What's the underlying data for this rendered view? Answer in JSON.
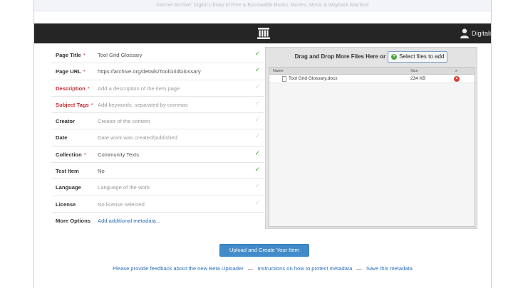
{
  "window": {
    "title": "Internet Archive: Digital Library of Free & Borrowable Books, Movies, Music & Wayback Machine"
  },
  "topbar": {
    "logo_icon": "archive-building-icon",
    "user_icon": "person-icon",
    "user_name": "Digitali"
  },
  "form": {
    "rows": [
      {
        "label": "Page Title",
        "star": "*",
        "required_red": false,
        "value": "Tool Grid Glossary",
        "placeholder": false,
        "link": false,
        "checked": true
      },
      {
        "label": "Page URL",
        "star": "*",
        "required_red": false,
        "value": "https://archive.org/details/ToolGridGlossary",
        "placeholder": false,
        "link": false,
        "checked": true
      },
      {
        "label": "Description",
        "star": "*",
        "required_red": true,
        "value": "Add a description of the item page",
        "placeholder": true,
        "link": false,
        "checked": false
      },
      {
        "label": "Subject Tags",
        "star": "*",
        "required_red": true,
        "value": "Add keywords, separated by commas",
        "placeholder": true,
        "link": false,
        "checked": false
      },
      {
        "label": "Creator",
        "star": "",
        "required_red": false,
        "value": "Creator of the content",
        "placeholder": true,
        "link": false,
        "checked": false
      },
      {
        "label": "Date",
        "star": "",
        "required_red": false,
        "value": "Date work was created/published",
        "placeholder": true,
        "link": false,
        "checked": false
      },
      {
        "label": "Collection",
        "star": "*",
        "required_red": false,
        "value": "Community Texts",
        "placeholder": false,
        "link": false,
        "checked": true
      },
      {
        "label": "Test Item",
        "star": "",
        "required_red": false,
        "value": "No",
        "placeholder": false,
        "link": false,
        "checked": true
      },
      {
        "label": "Language",
        "star": "",
        "required_red": false,
        "value": "Language of the work",
        "placeholder": true,
        "link": false,
        "checked": false
      },
      {
        "label": "License",
        "star": "",
        "required_red": false,
        "value": "No license selected",
        "placeholder": true,
        "link": false,
        "checked": false
      },
      {
        "label": "More Options",
        "star": "",
        "required_red": false,
        "value": "Add additional metadata...",
        "placeholder": false,
        "link": true,
        "checked": null
      }
    ]
  },
  "dropzone": {
    "prompt": "Drag and Drop More Files Here or",
    "select_button": "Select files to add",
    "columns": {
      "name": "Name",
      "size": "Size",
      "action": "x"
    },
    "files": [
      {
        "name": "Tool Grid Glossary.docx",
        "size": "234 KB"
      }
    ]
  },
  "actions": {
    "upload_button": "Upload and Create Your Item"
  },
  "footer": {
    "feedback": "Please provide feedback about the new Beta Uploader",
    "instructions": "Instructions on how to protect metadata",
    "save": "Save this metadata",
    "separator": "—"
  }
}
